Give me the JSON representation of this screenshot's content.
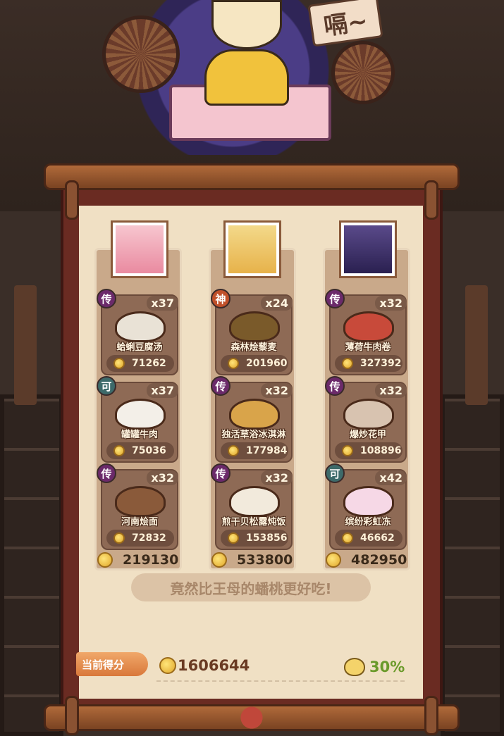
{
  "header": {
    "speech": "嗝~"
  },
  "columns": [
    {
      "total": "219130",
      "dishes": [
        {
          "tier": "传",
          "tier_color": "#6b2a6a",
          "qty": "x37",
          "name": "蛤蜊豆腐汤",
          "price": "71262",
          "art_color": "#e9e2d6"
        },
        {
          "tier": "可",
          "tier_color": "#3d6a6a",
          "qty": "x37",
          "name": "罐罐牛肉",
          "price": "75036",
          "art_color": "#f3efe8"
        },
        {
          "tier": "传",
          "tier_color": "#6b2a6a",
          "qty": "x32",
          "name": "河南烩面",
          "price": "72832",
          "art_color": "#8a5a3a"
        }
      ]
    },
    {
      "total": "533800",
      "dishes": [
        {
          "tier": "神",
          "tier_color": "#c0502a",
          "qty": "x24",
          "name": "森林烩藜麦",
          "price": "201960",
          "art_color": "#7a5a2a"
        },
        {
          "tier": "传",
          "tier_color": "#6b2a6a",
          "qty": "x32",
          "name": "独活草浴冰淇淋",
          "price": "177984",
          "art_color": "#d9a44a"
        },
        {
          "tier": "传",
          "tier_color": "#6b2a6a",
          "qty": "x32",
          "name": "煎干贝松露炖饭",
          "price": "153856",
          "art_color": "#f2eadc"
        }
      ]
    },
    {
      "total": "482950",
      "dishes": [
        {
          "tier": "传",
          "tier_color": "#6b2a6a",
          "qty": "x32",
          "name": "薄荷牛肉卷",
          "price": "327392",
          "art_color": "#c84a3a"
        },
        {
          "tier": "传",
          "tier_color": "#6b2a6a",
          "qty": "x32",
          "name": "爆炒花甲",
          "price": "108896",
          "art_color": "#d8c3b0"
        },
        {
          "tier": "可",
          "tier_color": "#3d6a6a",
          "qty": "x42",
          "name": "缤纷彩虹冻",
          "price": "46662",
          "art_color": "#f6d8e6"
        }
      ]
    }
  ],
  "comment": "竟然比王母的蟠桃更好吃!",
  "score": {
    "label": "当前得分",
    "value": "1606644",
    "percent": "30%"
  },
  "colors": {
    "paper": "#f0e0c4",
    "frame": "#6a2b22",
    "accent": "#d9783a",
    "percent": "#6a9a2a"
  }
}
